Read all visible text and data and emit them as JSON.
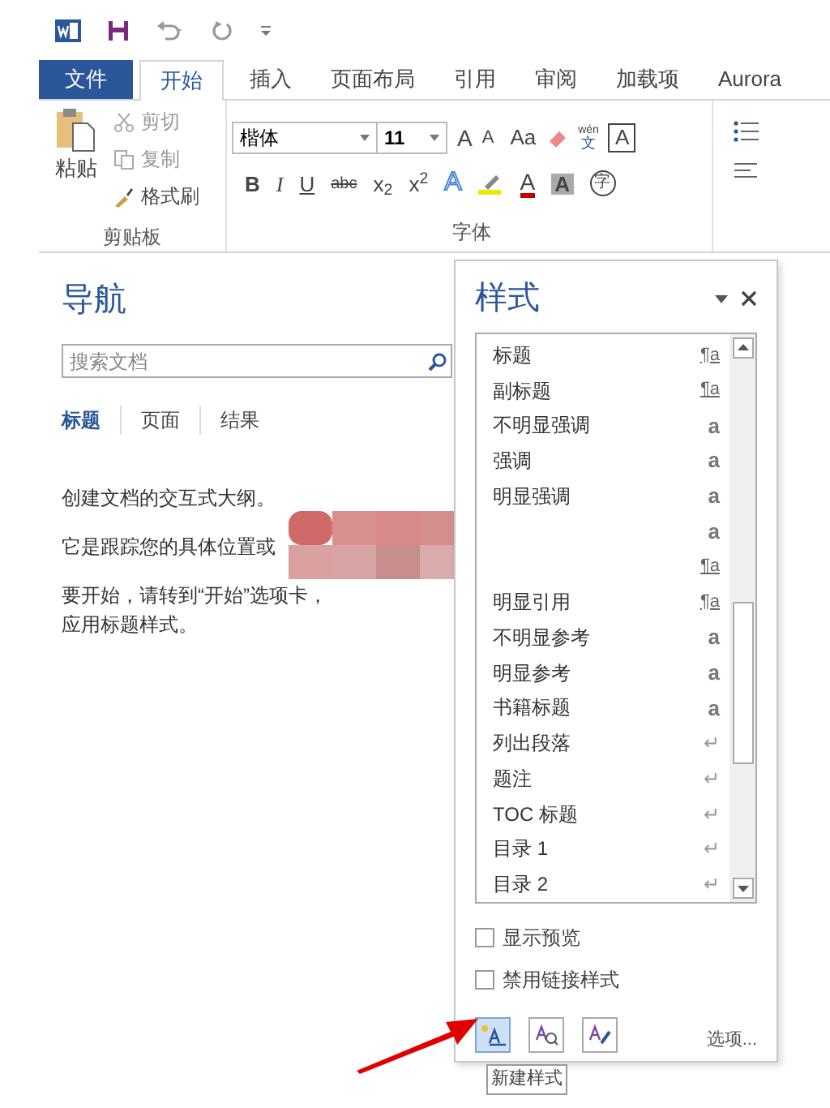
{
  "quick_access": {
    "buttons": [
      {
        "kind": "save"
      },
      {
        "kind": "undo"
      },
      {
        "kind": "redo"
      },
      {
        "kind": "customize"
      }
    ]
  },
  "ribbon_tabs": [
    {
      "label": "文件",
      "kind": "file",
      "selected": false
    },
    {
      "label": "开始",
      "kind": "tab",
      "selected": true
    },
    {
      "label": "插入",
      "kind": "tab",
      "selected": false
    },
    {
      "label": "页面布局",
      "kind": "tab",
      "selected": false
    },
    {
      "label": "引用",
      "kind": "tab",
      "selected": false
    },
    {
      "label": "审阅",
      "kind": "tab",
      "selected": false
    },
    {
      "label": "加载项",
      "kind": "tab",
      "selected": false
    },
    {
      "label": "Aurora",
      "kind": "tab",
      "selected": false
    }
  ],
  "clipboard": {
    "paste": "粘贴",
    "cut": "剪切",
    "copy": "复制",
    "format_painter": "格式刷",
    "group_label": "剪贴板"
  },
  "font": {
    "font_name": "楷体",
    "font_size": "11",
    "grow": "A",
    "shrink": "A",
    "change_case": "Aa",
    "phonetic_top": "wén",
    "phonetic_bottom": "文",
    "border": "A",
    "bold": "B",
    "italic": "I",
    "underline": "U",
    "strike": "abc",
    "subscript": "x$_{2}$",
    "superscript": "x$^{2}$",
    "text_effect": "A",
    "font_color": "A",
    "shading": "A",
    "enclose": "字",
    "group_label": "字体"
  },
  "navigation": {
    "title": "导航",
    "search": {
      "placeholder": "搜索文档"
    },
    "tabs": [
      {
        "label": "标题",
        "selected": true
      },
      {
        "label": "页面",
        "selected": false
      },
      {
        "label": "结果",
        "selected": false
      }
    ],
    "lines": [
      "创建文档的交互式大纲。",
      "它是跟踪您的具体位置或",
      "要开始，请转到“开始”选项卡，",
      "应用标题样式。"
    ]
  },
  "styles_pane": {
    "title": "样式",
    "items": [
      {
        "name": "标题",
        "kind": "linked",
        "mark": "¶a"
      },
      {
        "name": "副标题",
        "kind": "linked",
        "mark": "¶a"
      },
      {
        "name": "不明显强调",
        "kind": "character",
        "mark": "a"
      },
      {
        "name": "强调",
        "kind": "character",
        "mark": "a"
      },
      {
        "name": "明显强调",
        "kind": "character",
        "mark": "a"
      },
      {
        "kind": "character",
        "mark": "a"
      },
      {
        "kind": "linked",
        "mark": "¶a"
      },
      {
        "name": "明显引用",
        "kind": "linked",
        "mark": "¶a"
      },
      {
        "name": "不明显参考",
        "kind": "character",
        "mark": "a"
      },
      {
        "name": "明显参考",
        "kind": "character",
        "mark": "a"
      },
      {
        "name": "书籍标题",
        "kind": "character",
        "mark": "a"
      },
      {
        "name": "列出段落",
        "kind": "paragraph",
        "mark": "↵"
      },
      {
        "name": "题注",
        "kind": "paragraph",
        "mark": "↵"
      },
      {
        "name": "TOC 标题",
        "kind": "paragraph",
        "mark": "↵"
      },
      {
        "name": "目录 1",
        "kind": "paragraph",
        "mark": "↵"
      },
      {
        "name": "目录 2",
        "kind": "paragraph",
        "mark": "↵"
      }
    ],
    "options": [
      {
        "label": "显示预览",
        "checked": false
      },
      {
        "label": "禁用链接样式",
        "checked": false
      }
    ],
    "options_link": "选项...",
    "tooltip": "新建样式"
  }
}
